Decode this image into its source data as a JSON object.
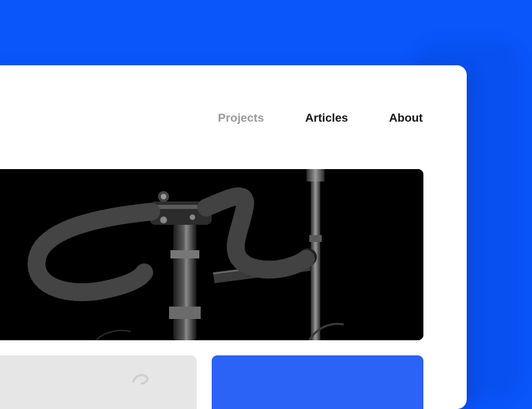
{
  "nav": {
    "items": [
      {
        "label": "Projects",
        "active": true
      },
      {
        "label": "Articles",
        "active": false
      },
      {
        "label": "About",
        "active": false
      }
    ]
  },
  "colors": {
    "background": "#0a56fb",
    "card": "#ffffff",
    "nav_active": "#9a9a9a",
    "nav_default": "#151515",
    "tile_gray": "#e6e6e6",
    "tile_blue": "#2a63f6"
  }
}
